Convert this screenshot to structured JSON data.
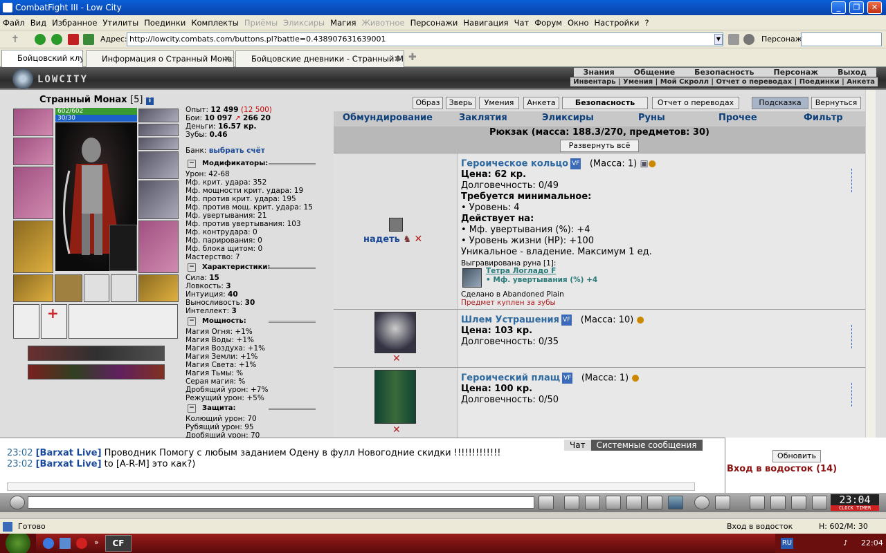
{
  "window": {
    "title": "CombatFight III - Low City"
  },
  "menu": [
    "Файл",
    "Вид",
    "Избранное",
    "Утилиты",
    "Поединки",
    "Комплекты",
    "Приёмы",
    "Эликсиры",
    "Магия",
    "Животное",
    "Персонажи",
    "Навигация",
    "Чат",
    "Форум",
    "Окно",
    "Настройки",
    "?"
  ],
  "menu_disabled": [
    "Приёмы",
    "Эликсиры",
    "Животное"
  ],
  "address": {
    "label": "Адрес:",
    "url": "http://lowcity.combats.com/buttons.pl?battle=0.438907631639001",
    "persona_label": "Персонаж:"
  },
  "tabs": [
    {
      "label": "Бойцовский клуб"
    },
    {
      "label": "Информация о Странный Монах"
    },
    {
      "label": "Бойцовские дневники - Странный М..."
    }
  ],
  "site": {
    "logo": "LOWCITY",
    "top_links": [
      "Знания",
      "Общение",
      "Безопасность",
      "Персонаж",
      "Выход"
    ],
    "sub_links": "Инвентарь | Умения | Мой Скролл | Отчет о переводах | Поединки | Анкета"
  },
  "character": {
    "name": "Странный Монах",
    "level": "[5]",
    "hp": "602/602",
    "mp": "30/30"
  },
  "stats": {
    "exp_label": "Опыт:",
    "exp": "12 499",
    "exp_next": "(12 500)",
    "battles_label": "Бои:",
    "battles": "10 097",
    "wins": "266",
    "losses": "20",
    "money_label": "Деньги:",
    "money": "16.57 кр.",
    "teeth_label": "Зубы:",
    "teeth": "0.46",
    "bank_label": "Банк:",
    "bank_link": "выбрать счёт"
  },
  "sections": {
    "mods": "Модификаторы:",
    "chars": "Характеристики:",
    "powers": "Мощность:",
    "defense": "Защита:"
  },
  "modifiers": [
    "Урон: 42-68",
    "Мф. крит. удара: 352",
    "Мф. мощности крит. удара: 19",
    "Мф. против крит. удара: 195",
    "Мф. против мощ. крит. удара: 15",
    "Мф. увертывания: 21",
    "Мф. против увертывания: 103",
    "Мф. контрудара: 0",
    "Мф. парирования: 0",
    "Мф. блока щитом: 0",
    "Мастерство: 7"
  ],
  "characteristics": [
    {
      "k": "Сила:",
      "v": "15"
    },
    {
      "k": "Ловкость:",
      "v": "3"
    },
    {
      "k": "Интуиция:",
      "v": "40"
    },
    {
      "k": "Выносливость:",
      "v": "30"
    },
    {
      "k": "Интеллект:",
      "v": "3"
    }
  ],
  "powers": [
    "Магия Огня: +1%",
    "Магия Воды: +1%",
    "Магия Воздуха: +1%",
    "Магия Земли: +1%",
    "Магия Света: +1%",
    "Магия Тьмы: %",
    "Серая магия: %",
    "Дробящий урон: +7%",
    "Режущий урон: +5%"
  ],
  "defense": [
    "Колющий урон: 70",
    "Рубящий урон: 95",
    "Дробящий урон: 70"
  ],
  "action_buttons": [
    "Образ",
    "Зверь",
    "Умения",
    "Анкета",
    "Безопасность",
    "Отчет о переводах",
    "Подсказка",
    "Вернуться"
  ],
  "inv_tabs": [
    "Обмундирование",
    "Заклятия",
    "Эликсиры",
    "Руны",
    "Прочее",
    "Фильтр"
  ],
  "backpack": {
    "title": "Рюкзак (масса: 188.3/270, предметов: 30)",
    "expand": "Развернуть всё"
  },
  "items": [
    {
      "name": "Героическое кольцо",
      "badge": "VF",
      "mass": "(Масса: 1)",
      "price": "Цена: 62 кр.",
      "durability": "Долговечность: 0/49",
      "req_title": "Требуется минимальное:",
      "req": "• Уровень: 4",
      "acts_title": "Действует на:",
      "acts": [
        "• Мф. увертывания (%): +4",
        "• Уровень жизни (HP): +100"
      ],
      "unique": "Уникальное - владение. Максимум 1 ед.",
      "rune_label": "Выгравирована руна [1]:",
      "rune_name": "Тетра Логладо F",
      "rune_effect": "• Мф. увертывания (%) +4",
      "made": "Сделано в Abandoned Plain",
      "bought": "Предмет куплен за зубы",
      "action": "надеть"
    },
    {
      "name": "Шлем Устрашения",
      "badge": "VF",
      "mass": "(Масса: 10)",
      "price": "Цена: 103 кр.",
      "durability": "Долговечность: 0/35"
    },
    {
      "name": "Героический плащ",
      "badge": "VF",
      "mass": "(Масса: 1)",
      "price": "Цена: 100 кр.",
      "durability": "Долговечность: 0/50"
    }
  ],
  "chat": {
    "tabs": [
      "Чат",
      "Системные сообщения"
    ],
    "lines": [
      {
        "time": "23:02",
        "nick": "[Barxat Live]",
        "text": "Проводник      Помогу с любым заданием       Одену в фулл   Новогодние скидки !!!!!!!!!!!!!"
      },
      {
        "time": "23:02",
        "nick": "[Barxat Live]",
        "text": "to [A-R-M] это как?)"
      }
    ]
  },
  "right_panel": {
    "refresh": "Обновить",
    "entry": "Вход в водосток (14)"
  },
  "clock": {
    "time": "23:04",
    "labels": "CLOCK  TIMER"
  },
  "status": {
    "left": "Готово",
    "center": "Вход в водосток",
    "right": "Н: 602/М: 30"
  },
  "taskbar": {
    "app": "CF",
    "lang": "RU",
    "time": "22:04"
  }
}
